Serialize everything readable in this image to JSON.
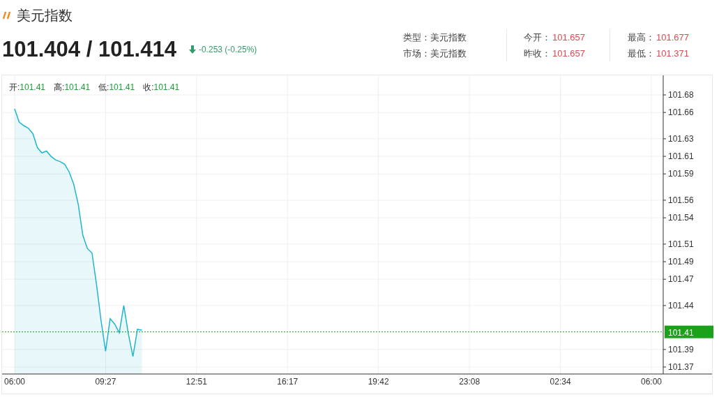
{
  "title": "美元指数",
  "quote": {
    "price": "101.404 / 101.414",
    "change": "-0.253 (-0.25%)"
  },
  "info": [
    {
      "label": "类型：",
      "value": "美元指数",
      "kind": "text"
    },
    {
      "label": "今开：",
      "value": "101.657",
      "kind": "price"
    },
    {
      "label": "最高：",
      "value": "101.677",
      "kind": "price"
    },
    {
      "label": "市场：",
      "value": "美元指数",
      "kind": "text"
    },
    {
      "label": "昨收：",
      "value": "101.657",
      "kind": "price"
    },
    {
      "label": "最低：",
      "value": "101.371",
      "kind": "price"
    }
  ],
  "ohlc": [
    {
      "label": "开:",
      "value": "101.41"
    },
    {
      "label": "高:",
      "value": "101.41"
    },
    {
      "label": "低:",
      "value": "101.41"
    },
    {
      "label": "收:",
      "value": "101.41"
    }
  ],
  "chart_data": {
    "type": "area",
    "categories": [
      "06:00",
      null,
      null,
      null,
      null,
      null,
      null,
      null,
      null,
      null,
      null,
      null,
      null,
      null,
      null,
      null,
      null,
      null,
      null,
      null,
      "09:27",
      null,
      null,
      null,
      null,
      null,
      null,
      null,
      null,
      null,
      null,
      null,
      null,
      null,
      null,
      null,
      null,
      null,
      null,
      null,
      "12:51",
      null,
      null,
      null,
      null,
      null,
      null,
      null,
      null,
      null,
      null,
      null,
      null,
      null,
      null,
      null,
      null,
      null,
      null,
      null,
      "16:17",
      null,
      null,
      null,
      null,
      null,
      null,
      null,
      null,
      null,
      null,
      null,
      null,
      null,
      null,
      null,
      null,
      null,
      null,
      null,
      "19:42",
      null,
      null,
      null,
      null,
      null,
      null,
      null,
      null,
      null,
      null,
      null,
      null,
      null,
      null,
      null,
      null,
      null,
      null,
      null,
      "23:08",
      null,
      null,
      null,
      null,
      null,
      null,
      null,
      null,
      null,
      null,
      null,
      null,
      null,
      null,
      null,
      null,
      null,
      null,
      null,
      "02:34",
      null,
      null,
      null,
      null,
      null,
      null,
      null,
      null,
      null,
      null,
      null,
      null,
      null,
      null,
      null,
      null,
      null,
      null,
      null,
      "06:00"
    ],
    "series": [
      {
        "color": "#1fb5d0",
        "values": [
          101.664,
          101.649,
          101.645,
          101.642,
          101.636,
          101.62,
          101.614,
          101.616,
          101.61,
          101.606,
          101.604,
          101.601,
          101.592,
          101.578,
          101.555,
          101.52,
          101.505,
          101.5,
          101.464,
          101.423,
          101.388,
          101.425,
          101.419,
          101.409,
          101.44,
          101.408,
          101.382,
          101.413,
          101.412,
          null,
          null,
          null,
          null,
          null,
          null,
          null,
          null,
          null,
          null,
          null,
          null,
          null,
          null,
          null,
          null,
          null,
          null,
          null,
          null,
          null,
          null,
          null,
          null,
          null,
          null,
          null,
          null,
          null,
          null,
          null,
          null,
          null,
          null,
          null,
          null,
          null,
          null,
          null,
          null,
          null,
          null,
          null,
          null,
          null,
          null,
          null,
          null,
          null,
          null,
          null,
          null,
          null,
          null,
          null,
          null,
          null,
          null,
          null,
          null,
          null,
          null,
          null,
          null,
          null,
          null,
          null,
          null,
          null,
          null,
          null,
          null,
          null,
          null,
          null,
          null,
          null,
          null,
          null,
          null,
          null,
          null,
          null,
          null,
          null,
          null,
          null,
          null,
          null,
          null,
          null,
          null,
          null,
          null,
          null,
          null,
          null,
          null,
          null,
          null,
          null,
          null,
          null,
          null,
          null,
          null,
          null,
          null,
          null,
          null,
          null,
          null
        ]
      }
    ],
    "ylim": [
      101.37,
      101.68
    ],
    "grid": true,
    "ref_lines": [
      {
        "axis": "y",
        "value": 101.41,
        "label": "101.41",
        "color": "#1aa31a"
      }
    ],
    "yticks": [
      101.68,
      101.66,
      101.63,
      101.61,
      101.59,
      101.56,
      101.54,
      101.51,
      101.49,
      101.47,
      101.44,
      101.39,
      101.37
    ]
  }
}
